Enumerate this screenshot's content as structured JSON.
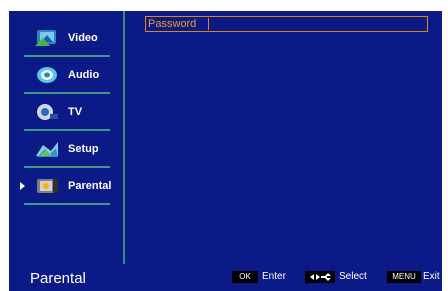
{
  "menu": {
    "items": [
      {
        "label": "Video",
        "icon": "video-icon",
        "selected": false
      },
      {
        "label": "Audio",
        "icon": "audio-icon",
        "selected": false
      },
      {
        "label": "TV",
        "icon": "tv-icon",
        "selected": false
      },
      {
        "label": "Setup",
        "icon": "setup-icon",
        "selected": false
      },
      {
        "label": "Parental",
        "icon": "parental-icon",
        "selected": true
      }
    ]
  },
  "content": {
    "password_label": "Password"
  },
  "status": {
    "title": "Parental",
    "ok_key": "OK",
    "enter_label": "Enter",
    "select_label": "Select",
    "menu_key": "MENU",
    "exit_label": "Exit"
  },
  "colors": {
    "background": "#0b1a86",
    "divider": "#3d9a82",
    "password_accent": "#e79b25"
  }
}
